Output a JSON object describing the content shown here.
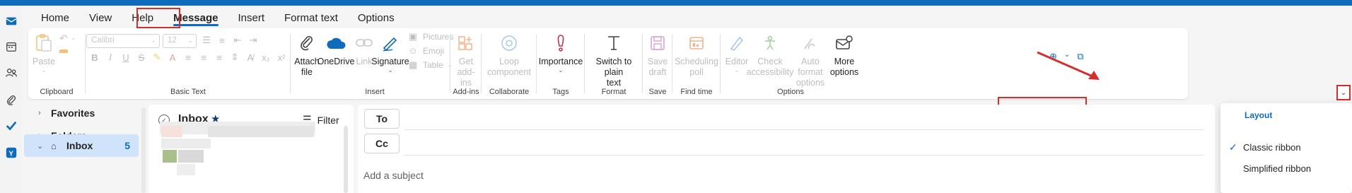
{
  "tabs": [
    {
      "label": "Home"
    },
    {
      "label": "View"
    },
    {
      "label": "Help"
    },
    {
      "label": "Message"
    },
    {
      "label": "Insert"
    },
    {
      "label": "Format text"
    },
    {
      "label": "Options"
    }
  ],
  "ribbon": {
    "clipboard": {
      "paste": "Paste",
      "group": "Clipboard"
    },
    "basic_text": {
      "font": "Calibri",
      "size": "12",
      "group": "Basic Text"
    },
    "insert": {
      "attach_line1": "Attach",
      "attach_line2": "file",
      "onedrive": "OneDrive",
      "link": "Link",
      "signature": "Signature",
      "pictures": "Pictures",
      "emoji": "Emoji",
      "table": "Table",
      "group": "Insert"
    },
    "addins": {
      "line1": "Get",
      "line2": "add-ins",
      "group": "Add-ins"
    },
    "collaborate": {
      "line1": "Loop",
      "line2": "component",
      "group": "Collaborate"
    },
    "tags": {
      "importance": "Importance",
      "group": "Tags"
    },
    "format": {
      "line1": "Switch to plain",
      "line2": "text",
      "group": "Format"
    },
    "save": {
      "line1": "Save",
      "line2": "draft",
      "group": "Save"
    },
    "findtime": {
      "line1": "Scheduling",
      "line2": "poll",
      "group": "Find time"
    },
    "options": {
      "editor": "Editor",
      "check_line1": "Check",
      "check_line2": "accessibility",
      "auto_line1": "Auto format",
      "auto_line2": "options",
      "more_line1": "More",
      "more_line2": "options",
      "group": "Options"
    }
  },
  "layout_menu": {
    "title": "Layout",
    "items": [
      {
        "label": "Classic ribbon",
        "checked": true
      },
      {
        "label": "Simplified ribbon",
        "checked": false
      }
    ]
  },
  "folders": {
    "favorites": "Favorites",
    "folders": "Folders",
    "inbox": "Inbox",
    "inbox_count": "5"
  },
  "message_list": {
    "title": "Inbox",
    "filter": "Filter"
  },
  "compose": {
    "to": "To",
    "cc": "Cc",
    "subject_placeholder": "Add a subject"
  },
  "colors": {
    "accent": "#0f6cbd",
    "annotation_red": "#d32f2f",
    "importance_red": "#c4314b"
  }
}
